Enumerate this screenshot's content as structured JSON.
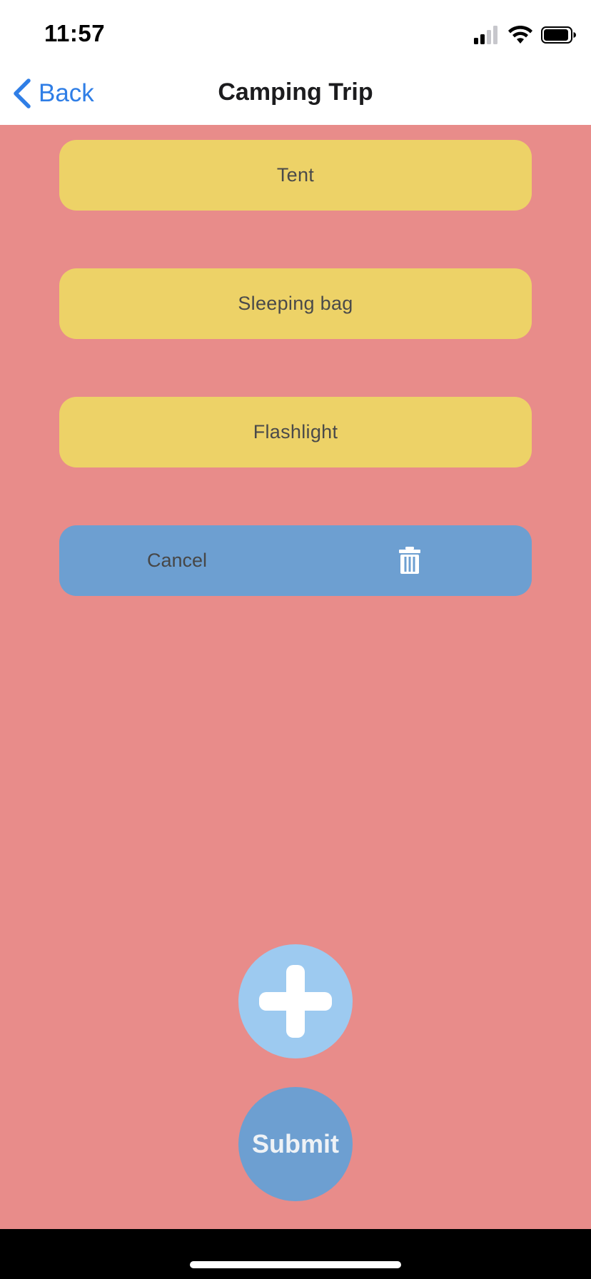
{
  "status_bar": {
    "time": "11:57",
    "icons": [
      "cellular-signal-icon",
      "wifi-icon",
      "battery-icon"
    ]
  },
  "nav": {
    "back_label": "Back",
    "title": "Camping Trip"
  },
  "items": [
    {
      "label": "Tent"
    },
    {
      "label": "Sleeping bag"
    },
    {
      "label": "Flashlight"
    }
  ],
  "action_row": {
    "cancel_label": "Cancel",
    "delete_icon": "trash-icon"
  },
  "add_button": {
    "icon": "plus-icon"
  },
  "submit_button": {
    "label": "Submit"
  },
  "colors": {
    "background": "#e88c8a",
    "item_card": "#edd267",
    "action_row": "#6d9fd1",
    "add_button": "#9dcaf0",
    "submit_button": "#6d9fd1",
    "accent": "#2f7ee6"
  }
}
